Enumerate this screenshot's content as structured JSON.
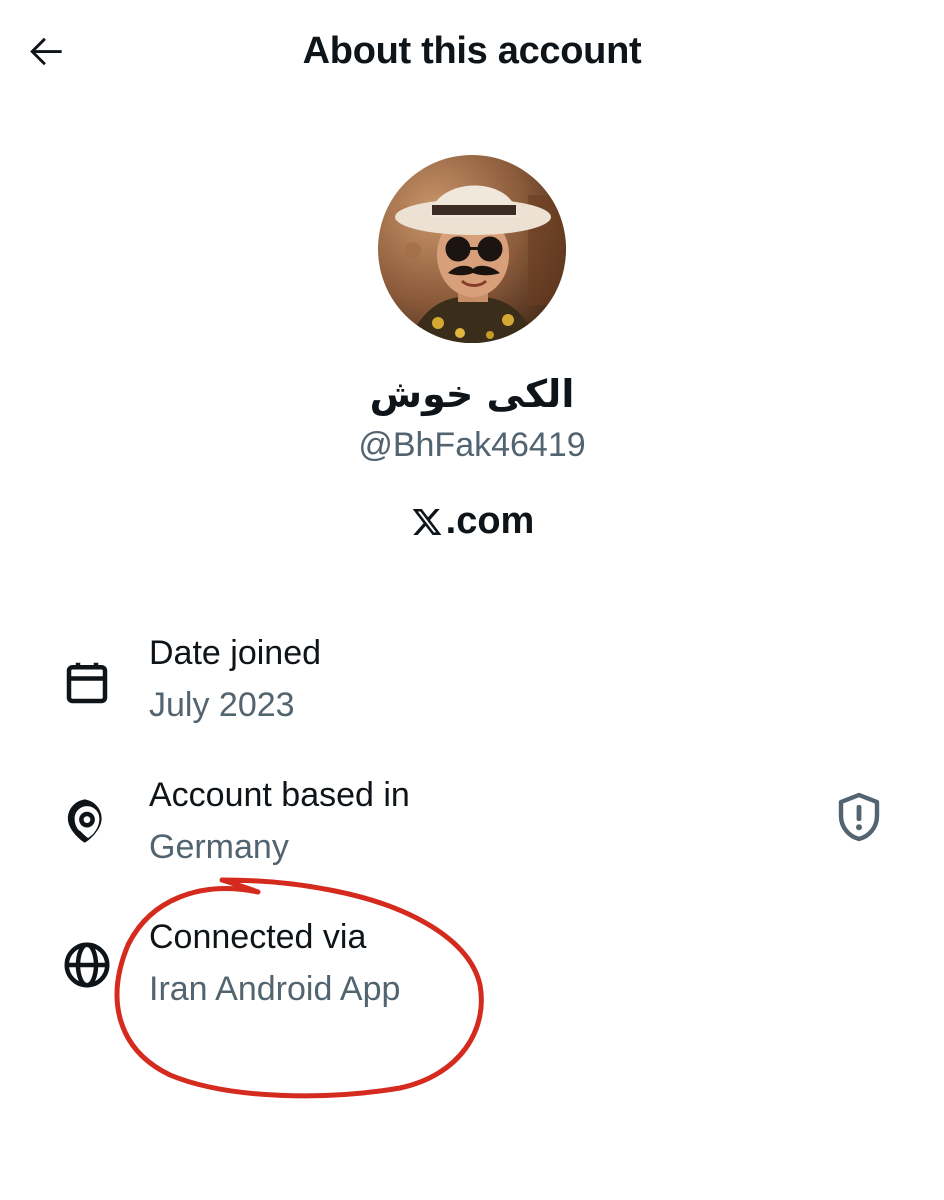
{
  "header": {
    "title": "About this account",
    "back_icon": "arrow-left-icon"
  },
  "profile": {
    "display_name": "الکی خوش",
    "handle": "@BhFak46419",
    "site_label": ".com",
    "site_logo_icon": "x-logo-icon"
  },
  "details": {
    "date_joined": {
      "label": "Date joined",
      "value": "July 2023",
      "icon": "calendar-icon"
    },
    "account_based": {
      "label": "Account based in",
      "value": "Germany",
      "icon": "location-pin-icon",
      "badge_icon": "shield-alert-icon"
    },
    "connected_via": {
      "label": "Connected via",
      "value": "Iran Android App",
      "icon": "globe-icon"
    }
  },
  "colors": {
    "text_primary": "#0f1419",
    "text_secondary": "#536471",
    "annotation_red": "#d42b1e"
  }
}
